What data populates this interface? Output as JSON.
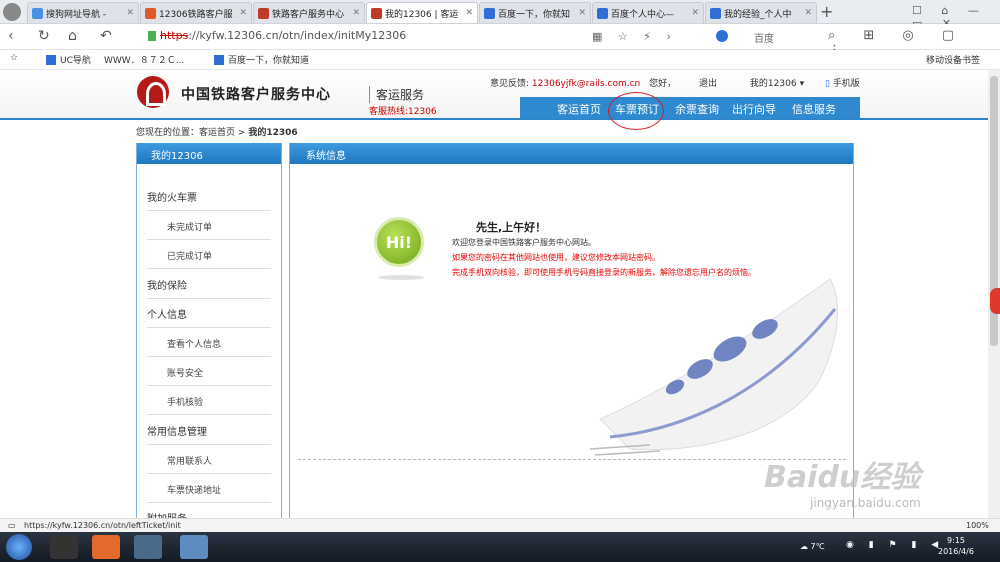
{
  "tabs": [
    {
      "label": "搜狗网址导航 -",
      "color": "#4a90e2"
    },
    {
      "label": "12306铁路客户服",
      "color": "#e05a2b"
    },
    {
      "label": "铁路客户服务中心",
      "color": "#c0392b"
    },
    {
      "label": "我的12306 | 客运",
      "color": "#c0392b",
      "active": true
    },
    {
      "label": "百度一下，你就知",
      "color": "#2e6fd6"
    },
    {
      "label": "百度个人中心—",
      "color": "#2e6fd6"
    },
    {
      "label": "我的经验_个人中",
      "color": "#2e6fd6"
    }
  ],
  "address": {
    "https": "https",
    "url": "://kyfw.12306.cn/otn/index/initMy12306",
    "search_engine": "百度"
  },
  "bookmarks": {
    "uc": "UC导航",
    "www": "WWW．８７２Ｃ...",
    "baidu": "百度一下，你就知道",
    "mobile": "移动设备书签"
  },
  "header": {
    "site_name": "中国铁路客户服务中心",
    "sub_name": "客运服务",
    "hotline": "客服热线:12306",
    "feedback_label": "意见反馈:",
    "feedback_email": "12306yjfk@rails.com.cn",
    "greeting": "您好，",
    "logout": "退出",
    "my12306": "我的12306",
    "mobile": "手机版",
    "nav": [
      "客运首页",
      "车票预订",
      "余票查询",
      "出行向导",
      "信息服务"
    ]
  },
  "breadcrumb": {
    "prefix": "您现在的位置：",
    "home": "客运首页",
    "sep": ">",
    "current": "我的12306"
  },
  "left_menu": {
    "title": "我的12306",
    "groups": [
      {
        "label": "我的火车票",
        "items": [
          "未完成订单",
          "已完成订单"
        ]
      },
      {
        "label": "我的保险",
        "items": []
      },
      {
        "label": "个人信息",
        "items": [
          "查看个人信息",
          "账号安全",
          "手机核验"
        ]
      },
      {
        "label": "常用信息管理",
        "items": [
          "常用联系人",
          "车票快递地址"
        ]
      },
      {
        "label": "附加服务",
        "items": []
      }
    ]
  },
  "panel": {
    "title": "系统信息",
    "hi": "Hi!",
    "greeting": "先生,上午好！",
    "welcome": "欢迎您登录中国铁路客户服务中心网站。",
    "warn1": "如果您的密码在其他网站也使用，建议您修改本网站密码。",
    "warn2": "完成手机双向核验，即可使用手机号码直接登录的新服务，解除您遗忘用户名的烦恼。"
  },
  "status": {
    "url": "https://kyfw.12306.cn/otn/leftTicket/init",
    "zoom": "100%"
  },
  "taskbar": {
    "temp": "7℃",
    "time": "9:15",
    "date": "2016/4/6"
  },
  "watermark": {
    "brand": "Baidu经验",
    "site": "jingyan.baidu.com"
  }
}
